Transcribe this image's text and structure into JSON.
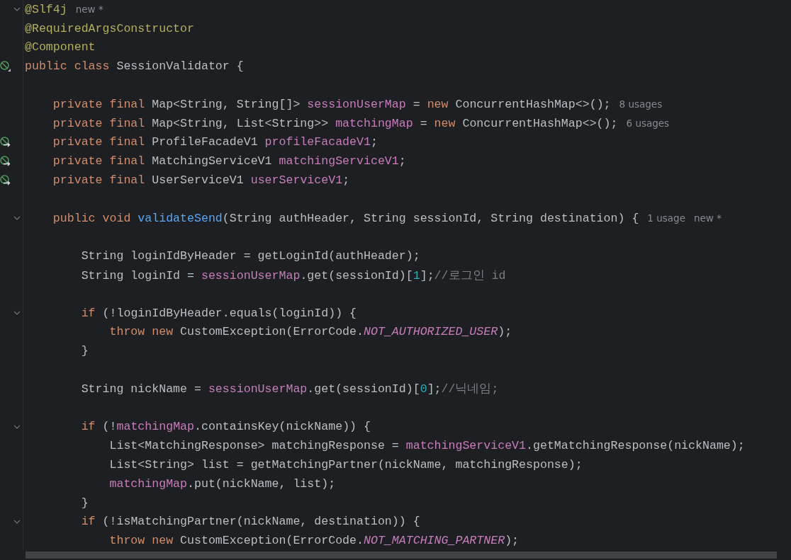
{
  "editor": {
    "lines": [
      {
        "fold": true,
        "tokens": [
          {
            "kind": "annotation",
            "text": "@Slf4j"
          }
        ],
        "hints": [
          "new *"
        ]
      },
      {
        "fold": false,
        "tokens": [
          {
            "kind": "annotation",
            "text": "@RequiredArgsConstructor"
          }
        ]
      },
      {
        "fold": false,
        "tokens": [
          {
            "kind": "annotation",
            "text": "@Component"
          }
        ]
      },
      {
        "fold": false,
        "gutter": {
          "kind": "bean"
        },
        "tokens": [
          {
            "kind": "keyword",
            "text": "public class "
          },
          {
            "kind": "plain",
            "text": "SessionValidator {"
          }
        ]
      },
      {
        "fold": false
      },
      {
        "fold": false,
        "tokens": [
          {
            "kind": "keyword",
            "text": "    private final "
          },
          {
            "kind": "plain",
            "text": "Map<String, String[]> "
          },
          {
            "kind": "field",
            "text": "sessionUserMap"
          },
          {
            "kind": "plain",
            "text": " = "
          },
          {
            "kind": "keyword",
            "text": "new "
          },
          {
            "kind": "plain",
            "text": "ConcurrentHashMap<>();"
          }
        ],
        "hints": [
          "8 usages"
        ]
      },
      {
        "fold": false,
        "tokens": [
          {
            "kind": "keyword",
            "text": "    private final "
          },
          {
            "kind": "plain",
            "text": "Map<String, List<String>> "
          },
          {
            "kind": "field",
            "text": "matchingMap"
          },
          {
            "kind": "plain",
            "text": " = "
          },
          {
            "kind": "keyword",
            "text": "new "
          },
          {
            "kind": "plain",
            "text": "ConcurrentHashMap<>();"
          }
        ],
        "hints": [
          "6 usages"
        ]
      },
      {
        "fold": false,
        "gutter": {
          "kind": "injected"
        },
        "tokens": [
          {
            "kind": "keyword",
            "text": "    private final "
          },
          {
            "kind": "plain",
            "text": "ProfileFacadeV1 "
          },
          {
            "kind": "field",
            "text": "profileFacadeV1"
          },
          {
            "kind": "plain",
            "text": ";"
          }
        ]
      },
      {
        "fold": false,
        "gutter": {
          "kind": "injected"
        },
        "tokens": [
          {
            "kind": "keyword",
            "text": "    private final "
          },
          {
            "kind": "plain",
            "text": "MatchingServiceV1 "
          },
          {
            "kind": "field",
            "text": "matchingServiceV1"
          },
          {
            "kind": "plain",
            "text": ";"
          }
        ]
      },
      {
        "fold": false,
        "gutter": {
          "kind": "injected"
        },
        "tokens": [
          {
            "kind": "keyword",
            "text": "    private final "
          },
          {
            "kind": "plain",
            "text": "UserServiceV1 "
          },
          {
            "kind": "field",
            "text": "userServiceV1"
          },
          {
            "kind": "plain",
            "text": ";"
          }
        ]
      },
      {
        "fold": false
      },
      {
        "fold": true,
        "tokens": [
          {
            "kind": "keyword",
            "text": "    public void "
          },
          {
            "kind": "method",
            "text": "validateSend"
          },
          {
            "kind": "plain",
            "text": "(String authHeader, String sessionId, String destination) {"
          }
        ],
        "hints": [
          "1 usage",
          "new *"
        ]
      },
      {
        "fold": false
      },
      {
        "fold": false,
        "tokens": [
          {
            "kind": "plain",
            "text": "        String loginIdByHeader = getLoginId(authHeader);"
          }
        ]
      },
      {
        "fold": false,
        "tokens": [
          {
            "kind": "plain",
            "text": "        String loginId = "
          },
          {
            "kind": "field",
            "text": "sessionUserMap"
          },
          {
            "kind": "plain",
            "text": ".get(sessionId)["
          },
          {
            "kind": "number",
            "text": "1"
          },
          {
            "kind": "plain",
            "text": "];"
          },
          {
            "kind": "comment",
            "text": "//로그인 id"
          }
        ]
      },
      {
        "fold": false
      },
      {
        "fold": true,
        "tokens": [
          {
            "kind": "keyword",
            "text": "        if "
          },
          {
            "kind": "plain",
            "text": "(!loginIdByHeader.equals(loginId)) {"
          }
        ]
      },
      {
        "fold": false,
        "tokens": [
          {
            "kind": "keyword",
            "text": "            throw new "
          },
          {
            "kind": "plain",
            "text": "CustomException(ErrorCode."
          },
          {
            "kind": "constant",
            "text": "NOT_AUTHORIZED_USER"
          },
          {
            "kind": "plain",
            "text": ");"
          }
        ]
      },
      {
        "fold": false,
        "tokens": [
          {
            "kind": "plain",
            "text": "        }"
          }
        ]
      },
      {
        "fold": false
      },
      {
        "fold": false,
        "tokens": [
          {
            "kind": "plain",
            "text": "        String nickName = "
          },
          {
            "kind": "field",
            "text": "sessionUserMap"
          },
          {
            "kind": "plain",
            "text": ".get(sessionId)["
          },
          {
            "kind": "number",
            "text": "0"
          },
          {
            "kind": "plain",
            "text": "];"
          },
          {
            "kind": "comment",
            "text": "//닉네임;"
          }
        ]
      },
      {
        "fold": false
      },
      {
        "fold": true,
        "tokens": [
          {
            "kind": "keyword",
            "text": "        if "
          },
          {
            "kind": "plain",
            "text": "(!"
          },
          {
            "kind": "field",
            "text": "matchingMap"
          },
          {
            "kind": "plain",
            "text": ".containsKey(nickName)) {"
          }
        ]
      },
      {
        "fold": false,
        "tokens": [
          {
            "kind": "plain",
            "text": "            List<MatchingResponse> matchingResponse = "
          },
          {
            "kind": "field",
            "text": "matchingServiceV1"
          },
          {
            "kind": "plain",
            "text": ".getMatchingResponse(nickName);"
          }
        ]
      },
      {
        "fold": false,
        "tokens": [
          {
            "kind": "plain",
            "text": "            List<String> list = getMatchingPartner(nickName, matchingResponse);"
          }
        ]
      },
      {
        "fold": false,
        "tokens": [
          {
            "kind": "field",
            "text": "            matchingMap"
          },
          {
            "kind": "plain",
            "text": ".put(nickName, list);"
          }
        ]
      },
      {
        "fold": false,
        "tokens": [
          {
            "kind": "plain",
            "text": "        }"
          }
        ]
      },
      {
        "fold": true,
        "tokens": [
          {
            "kind": "keyword",
            "text": "        if "
          },
          {
            "kind": "plain",
            "text": "(!isMatchingPartner(nickName, destination)) {"
          }
        ]
      },
      {
        "fold": false,
        "tokens": [
          {
            "kind": "keyword",
            "text": "            throw new "
          },
          {
            "kind": "plain",
            "text": "CustomException(ErrorCode."
          },
          {
            "kind": "constant",
            "text": "NOT_MATCHING_PARTNER"
          },
          {
            "kind": "plain",
            "text": ");"
          }
        ]
      }
    ]
  }
}
